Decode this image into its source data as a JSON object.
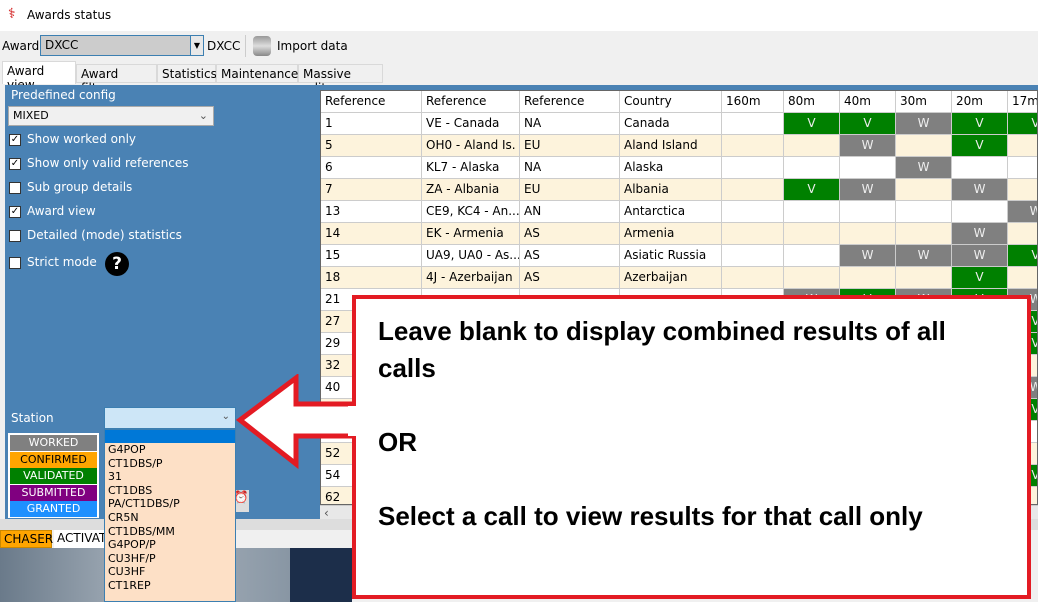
{
  "window": {
    "title": "Awards status",
    "icon": "awards-app-icon"
  },
  "toolbar": {
    "award_label": "Award",
    "award_value": "DXCC",
    "award_name": "DXCC",
    "import_label": "Import data"
  },
  "tabs": [
    "Award view",
    "Award filters",
    "Statistics",
    "Maintenance",
    "Massive editor"
  ],
  "left": {
    "predefined_label": "Predefined config",
    "predefined_value": "MIXED",
    "options": [
      {
        "label": "Show worked only",
        "checked": true
      },
      {
        "label": "Show only valid references",
        "checked": true
      },
      {
        "label": "Sub group details",
        "checked": false
      },
      {
        "label": "Award view",
        "checked": true
      },
      {
        "label": "Detailed (mode) statistics",
        "checked": false
      },
      {
        "label": "Strict mode",
        "checked": false
      }
    ],
    "station_label": "Station",
    "station_value": "",
    "legend": [
      {
        "label": "WORKED",
        "color": "#808080",
        "text": "#fff"
      },
      {
        "label": "CONFIRMED",
        "color": "#ffa500",
        "text": "#000"
      },
      {
        "label": "VALIDATED",
        "color": "#008000",
        "text": "#fff"
      },
      {
        "label": "SUBMITTED",
        "color": "#800080",
        "text": "#fff"
      },
      {
        "label": "GRANTED",
        "color": "#1e90ff",
        "text": "#fff"
      }
    ],
    "station_options": [
      "G4POP",
      "CT1DBS/P",
      "31",
      "CT1DBS",
      "PA/CT1DBS/P",
      "CR5N",
      "CT1DBS/MM",
      "G4POP/P",
      "CU3HF/P",
      "CU3HF",
      "CT1REP"
    ]
  },
  "table": {
    "headers": [
      "Reference",
      "Reference",
      "Reference",
      "Country",
      "160m",
      "80m",
      "40m",
      "30m",
      "20m",
      "17m"
    ],
    "rows": [
      {
        "cells": [
          "1",
          "VE - Canada",
          "NA",
          "Canada"
        ],
        "bands": [
          "",
          "V",
          "V",
          "W",
          "V",
          "V"
        ]
      },
      {
        "cells": [
          "5",
          "OH0 - Aland Is.",
          "EU",
          "Aland Island"
        ],
        "bands": [
          "",
          "",
          "W",
          "",
          "V",
          ""
        ]
      },
      {
        "cells": [
          "6",
          "KL7 - Alaska",
          "NA",
          "Alaska"
        ],
        "bands": [
          "",
          "",
          "",
          "W",
          "",
          ""
        ]
      },
      {
        "cells": [
          "7",
          "ZA - Albania",
          "EU",
          "Albania"
        ],
        "bands": [
          "",
          "V",
          "W",
          "",
          "W",
          ""
        ]
      },
      {
        "cells": [
          "13",
          "CE9, KC4 - An...",
          "AN",
          "Antarctica"
        ],
        "bands": [
          "",
          "",
          "",
          "",
          "",
          "W"
        ]
      },
      {
        "cells": [
          "14",
          "EK - Armenia",
          "AS",
          "Armenia"
        ],
        "bands": [
          "",
          "",
          "",
          "",
          "W",
          ""
        ]
      },
      {
        "cells": [
          "15",
          "UA9, UA0 - As...",
          "AS",
          "Asiatic Russia"
        ],
        "bands": [
          "",
          "",
          "W",
          "W",
          "W",
          "V"
        ]
      },
      {
        "cells": [
          "18",
          "4J - Azerbaijan",
          "AS",
          "Azerbaijan"
        ],
        "bands": [
          "",
          "",
          "",
          "",
          "V",
          ""
        ]
      },
      {
        "cells": [
          "21",
          "",
          "",
          ""
        ],
        "bands": [
          "",
          "W",
          "V",
          "W",
          "V",
          "W"
        ]
      },
      {
        "cells": [
          "27",
          "",
          "",
          ""
        ],
        "bands": [
          "",
          "",
          "",
          "",
          "",
          "V"
        ]
      },
      {
        "cells": [
          "29",
          "",
          "",
          ""
        ],
        "bands": [
          "",
          "",
          "",
          "",
          "",
          "V"
        ]
      },
      {
        "cells": [
          "32",
          "",
          "",
          ""
        ],
        "bands": [
          "",
          "",
          "",
          "",
          "",
          ""
        ]
      },
      {
        "cells": [
          "40",
          "",
          "",
          ""
        ],
        "bands": [
          "",
          "",
          "",
          "",
          "",
          "W"
        ]
      },
      {
        "cells": [
          "",
          "",
          "",
          ""
        ],
        "bands": [
          "",
          "",
          "",
          "",
          "",
          "V"
        ]
      },
      {
        "cells": [
          "",
          "",
          "",
          ""
        ],
        "bands": [
          "",
          "",
          "",
          "",
          "",
          ""
        ]
      },
      {
        "cells": [
          "52",
          "",
          "",
          ""
        ],
        "bands": [
          "",
          "",
          "",
          "",
          "",
          ""
        ]
      },
      {
        "cells": [
          "54",
          "",
          "",
          ""
        ],
        "bands": [
          "",
          "",
          "",
          "",
          "",
          "V"
        ]
      },
      {
        "cells": [
          "62",
          "",
          "",
          ""
        ],
        "bands": [
          "",
          "",
          "",
          "",
          "",
          ""
        ]
      }
    ]
  },
  "bottom_tabs": {
    "chaser": "CHASER",
    "activator": "ACTIVATOR"
  },
  "callout": {
    "line1": "Leave blank to display combined results of all calls",
    "line2": "OR",
    "line3": "Select a call to view results for that call only"
  },
  "colors": {
    "worked": "#808080",
    "validated": "#008000",
    "row_alt": "#fdf3dc",
    "panel": "#4a82b4",
    "callout_border": "#e31b23"
  }
}
